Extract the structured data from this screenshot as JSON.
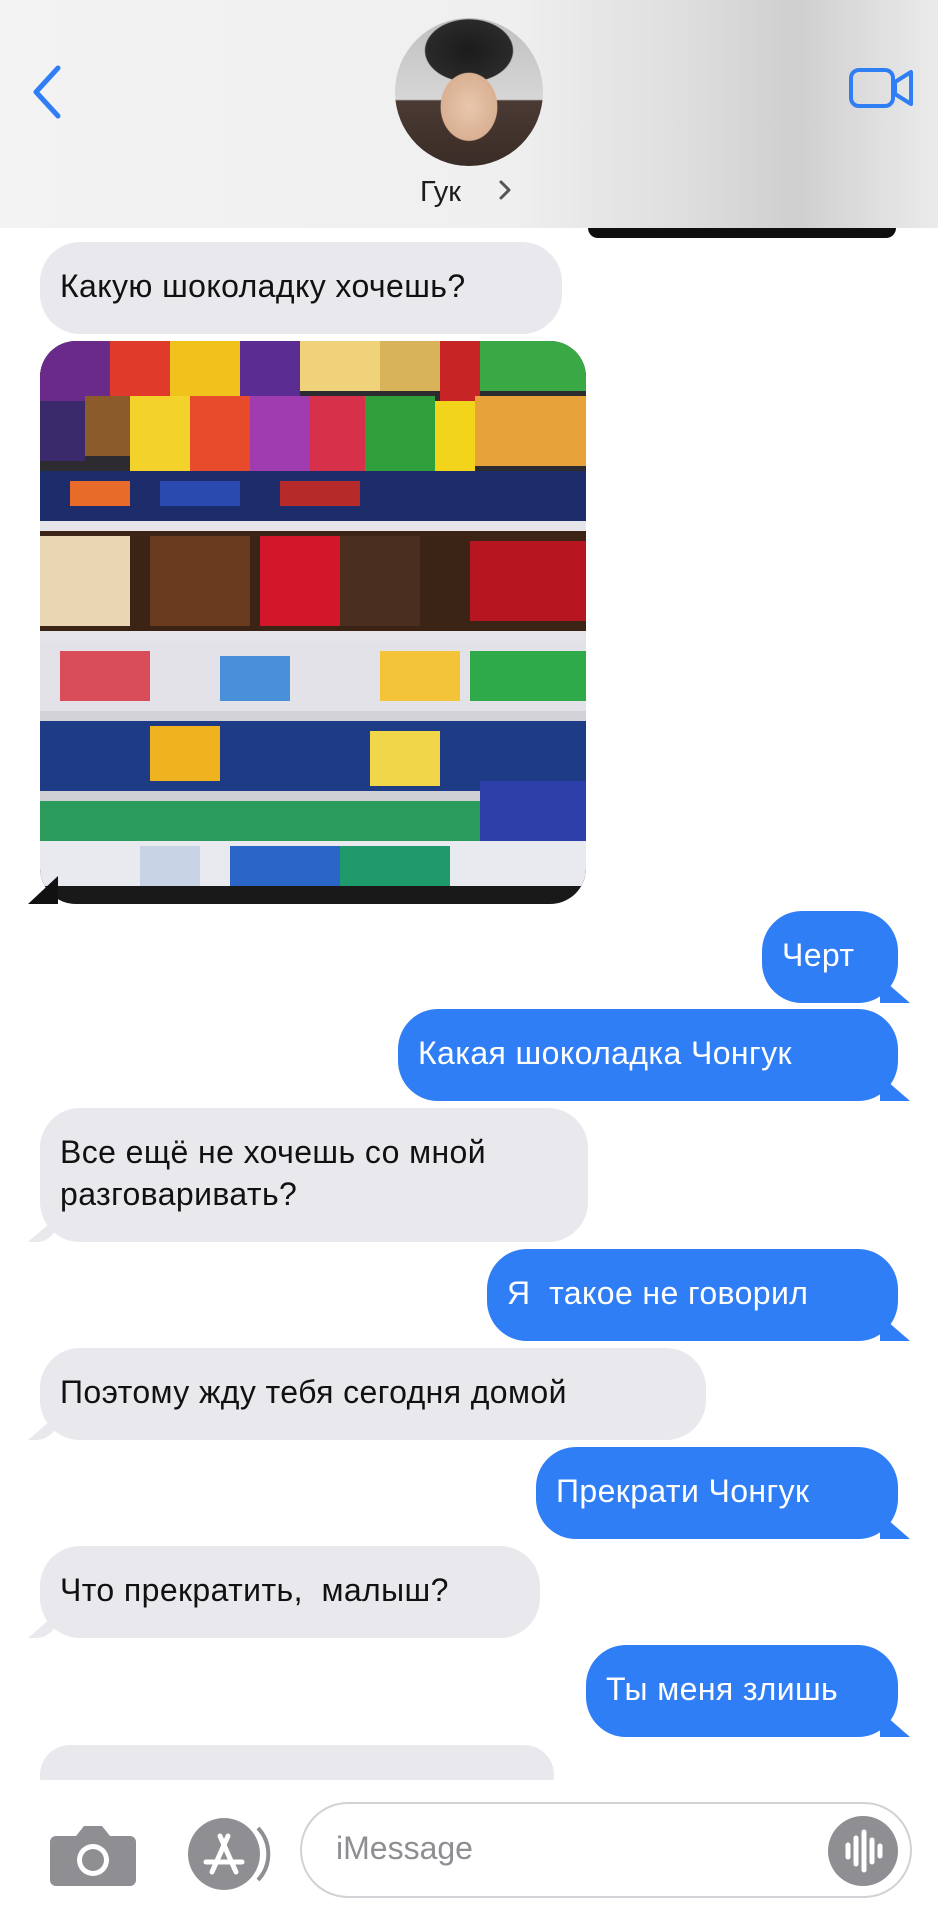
{
  "header": {
    "contact_name": "Гук",
    "back_icon": "chevron-left-icon",
    "video_icon": "video-camera-icon",
    "accent_color": "#2f7ef6"
  },
  "messages": [
    {
      "side": "in",
      "text": "Какую шоколадку хочешь?"
    },
    {
      "side": "in",
      "type": "photo",
      "description_icon": "photo-attachment"
    },
    {
      "side": "out",
      "text": "Черт"
    },
    {
      "side": "out",
      "text": "Какая шоколадка Чонгук"
    },
    {
      "side": "in",
      "text": "Все ещё не хочешь со мной\nразговаривать?"
    },
    {
      "side": "out",
      "text": "Я  такое не говорил"
    },
    {
      "side": "in",
      "text": "Поэтому жду тебя сегодня домой"
    },
    {
      "side": "out",
      "text": "Прекрати Чонгук"
    },
    {
      "side": "in",
      "text": "Что прекратить,  малыш?"
    },
    {
      "side": "out",
      "text": "Ты меня злишь"
    }
  ],
  "composer": {
    "placeholder": "iMessage",
    "camera_icon": "camera-icon",
    "apps_icon": "app-store-icon",
    "audio_icon": "audio-waveform-icon"
  },
  "colors": {
    "incoming_bubble": "#e8e8ed",
    "outgoing_bubble": "#2f7ef6"
  }
}
